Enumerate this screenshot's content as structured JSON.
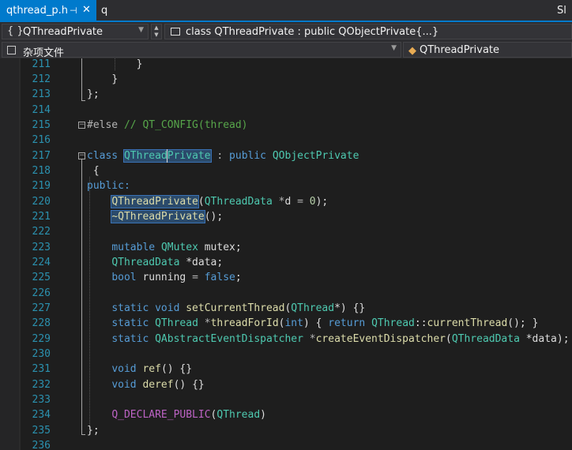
{
  "tabs": {
    "active_label": "qthread_p.h",
    "pin_glyph": "⊣",
    "close_glyph": "✕",
    "second_label": "q",
    "right_label": "Sl"
  },
  "nav": {
    "scope_icon_glyph": "{ }",
    "scope": "QThreadPrivate",
    "member": "class QThreadPrivate : public QObjectPrivate{...}",
    "project": "杂项文件",
    "class": "QThreadPrivate",
    "dropdown_arrow": "▼",
    "spinner_up": "▲",
    "spinner_down": "▼"
  },
  "icons": {
    "scope": "braces-icon",
    "member": "class-member-icon",
    "project": "project-file-icon",
    "class": "class-icon"
  },
  "colors": {
    "accent": "#007acc",
    "keyword": "#569cd6",
    "type": "#4ec9b0",
    "function": "#dcdcaa",
    "comment": "#57a64a",
    "macro": "#bd63c5",
    "line_number": "#2b91af"
  },
  "code": {
    "line_numbers": [
      "211",
      "212",
      "213",
      "214",
      "215",
      "216",
      "217",
      "218",
      "219",
      "220",
      "221",
      "222",
      "223",
      "224",
      "225",
      "226",
      "227",
      "228",
      "229",
      "230",
      "231",
      "232",
      "233",
      "234",
      "235",
      "236"
    ],
    "fold_minus": "−",
    "l211": "}",
    "l212": "}",
    "l213": "};",
    "l215_directive": "#else",
    "l215_comment": "// QT_CONFIG(thread)",
    "l217_class": "class",
    "l217_name_a": "QThread",
    "l217_name_b": "Private",
    "l217_colon": ":",
    "l217_public": "public",
    "l217_base": "QObjectPrivate",
    "l218": "{",
    "l219": "public:",
    "l220_ctor": "QThreadPrivate",
    "l220_paren": "(",
    "l220_type": "QThreadData",
    "l220_ptr": "*",
    "l220_param": "d",
    "l220_eq": "=",
    "l220_zero": "0",
    "l220_end": ");",
    "l221_dtor": "~QThreadPrivate",
    "l221_end": "();",
    "l223_kw": "mutable",
    "l223_type": "QMutex",
    "l223_rest": "mutex;",
    "l224_type": "QThreadData",
    "l224_rest": "*data;",
    "l225_kw": "bool",
    "l225_name": "running",
    "l225_eq": "=",
    "l225_false": "false",
    "l225_semi": ";",
    "l227_kw": "static void",
    "l227_fn": "setCurrentThread",
    "l227_open": "(",
    "l227_type": "QThread",
    "l227_rest": "*) {}",
    "l228_kw": "static",
    "l228_type": "QThread",
    "l228_ptr": "*",
    "l228_fn": "threadForId",
    "l228_args_open": "(",
    "l228_int": "int",
    "l228_args_close": ") {",
    "l228_return": "return",
    "l228_cls": "QThread",
    "l228_scope": "::",
    "l228_call": "currentThread",
    "l228_end": "(); }",
    "l229_kw": "static",
    "l229_type": "QAbstractEventDispatcher",
    "l229_ptr": "*",
    "l229_fn": "createEventDispatcher",
    "l229_open": "(",
    "l229_argtype": "QThreadData",
    "l229_rest": "*data);",
    "l231_kw": "void",
    "l231_fn": "ref",
    "l231_rest": "() {}",
    "l232_kw": "void",
    "l232_fn": "deref",
    "l232_rest": "() {}",
    "l234_macro": "Q_DECLARE_PUBLIC",
    "l234_open": "(",
    "l234_type": "QThread",
    "l234_close": ")",
    "l235": "};"
  }
}
